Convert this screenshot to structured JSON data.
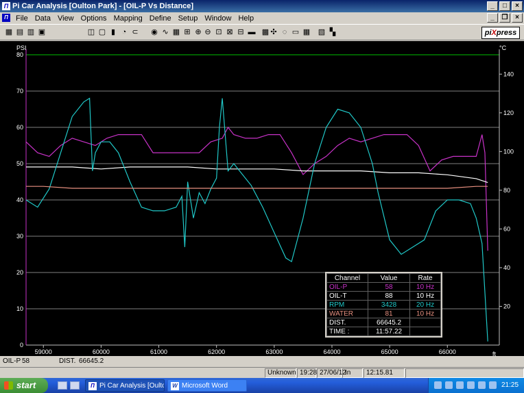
{
  "window": {
    "title": "Pi Car Analysis [Oulton Park] - [OIL-P Vs Distance]",
    "app_icon": "Π"
  },
  "menu": [
    "File",
    "Data",
    "View",
    "Options",
    "Mapping",
    "Define",
    "Setup",
    "Window",
    "Help"
  ],
  "logo": {
    "pre": "pi",
    "mid": "X",
    "post": "press"
  },
  "toolbar_icons": [
    "chart-icon",
    "open-icon",
    "save-icon",
    "print-icon",
    "new-window-icon",
    "folder-icon",
    "bar-icon",
    "gauge-icon",
    "link-icon",
    "eye-icon",
    "waveform-icon",
    "grid-split-icon",
    "cursor-icon",
    "zoom-in-icon",
    "zoom-out-icon",
    "zoom-box-icon",
    "zoom-fit-icon",
    "zoom-all-icon",
    "car-icon",
    "map-icon",
    "telemetry-icon",
    "track-icon",
    "race-car-icon",
    "table-icon",
    "compare-icon",
    "checker-icon"
  ],
  "chart_data": {
    "type": "line",
    "xlabel": "ft",
    "x_ticks": [
      59000,
      60000,
      61000,
      62000,
      63000,
      64000,
      65000,
      66000
    ],
    "xlim": [
      58700,
      66900
    ],
    "y_left": {
      "label": "PSI",
      "ticks": [
        0,
        10,
        20,
        30,
        40,
        50,
        60,
        70,
        80
      ],
      "lim": [
        0,
        80
      ]
    },
    "y_right": {
      "label": "°C",
      "ticks": [
        20,
        40,
        60,
        80,
        100,
        120,
        140
      ],
      "lim": [
        0,
        150
      ]
    },
    "series": [
      {
        "name": "OIL-P",
        "axis": "left",
        "color": "#c832c8",
        "x": [
          58700,
          58900,
          59100,
          59300,
          59500,
          59700,
          59900,
          60100,
          60300,
          60500,
          60700,
          60900,
          61100,
          61300,
          61500,
          61700,
          61900,
          62100,
          62200,
          62300,
          62500,
          62700,
          62900,
          63100,
          63300,
          63500,
          63700,
          63900,
          64100,
          64300,
          64500,
          64700,
          64900,
          65100,
          65300,
          65500,
          65700,
          65900,
          66100,
          66300,
          66500,
          66600,
          66650,
          66700
        ],
        "y": [
          56,
          53,
          52,
          55,
          57,
          56,
          55,
          57,
          58,
          58,
          58,
          53,
          53,
          53,
          53,
          53,
          56,
          57,
          60,
          58,
          57,
          57,
          58,
          58,
          53,
          47,
          50,
          52,
          55,
          57,
          56,
          57,
          58,
          58,
          58,
          55,
          48,
          51,
          52,
          52,
          52,
          58,
          53,
          26
        ]
      },
      {
        "name": "OIL-T",
        "axis": "right",
        "color": "#ffffff",
        "x": [
          58700,
          59000,
          59500,
          60000,
          60500,
          61000,
          61500,
          62000,
          62500,
          63000,
          63500,
          64000,
          64500,
          65000,
          65500,
          66000,
          66500,
          66700
        ],
        "y": [
          92,
          92,
          92,
          91,
          92,
          92,
          92,
          91,
          91,
          91,
          90,
          90,
          90,
          89,
          89,
          88,
          86,
          84
        ]
      },
      {
        "name": "RPM",
        "axis": "left",
        "color": "#20c8c8",
        "x": [
          58700,
          58900,
          59100,
          59300,
          59500,
          59700,
          59800,
          59850,
          59900,
          60000,
          60150,
          60300,
          60500,
          60700,
          60900,
          61100,
          61300,
          61400,
          61450,
          61500,
          61600,
          61700,
          61800,
          61900,
          62000,
          62050,
          62100,
          62200,
          62300,
          62400,
          62600,
          62800,
          63000,
          63200,
          63300,
          63500,
          63700,
          63900,
          64100,
          64300,
          64500,
          64700,
          64800,
          65000,
          65200,
          65400,
          65600,
          65800,
          66000,
          66200,
          66400,
          66500,
          66600,
          66700
        ],
        "y": [
          40,
          38,
          43,
          53,
          63,
          67,
          68,
          48,
          53,
          56,
          56,
          53,
          45,
          38,
          37,
          37,
          38,
          41,
          27,
          45,
          35,
          42,
          39,
          43,
          46,
          60,
          68,
          48,
          50,
          48,
          44,
          38,
          31,
          24,
          23,
          35,
          50,
          60,
          65,
          64,
          60,
          50,
          42,
          29,
          25,
          27,
          29,
          37,
          40,
          40,
          39,
          35,
          28,
          1
        ]
      },
      {
        "name": "WATER",
        "axis": "right",
        "color": "#e89080",
        "x": [
          58700,
          59000,
          59500,
          60000,
          60500,
          61000,
          61500,
          62000,
          62500,
          63000,
          63500,
          64000,
          64500,
          65000,
          65500,
          66000,
          66500,
          66700
        ],
        "y": [
          82,
          82,
          81,
          81,
          81,
          81,
          81,
          81,
          81,
          81,
          81,
          81,
          81,
          81,
          81,
          81,
          82,
          82
        ]
      }
    ]
  },
  "readout_table": {
    "headers": [
      "Channel",
      "Value",
      "Rate"
    ],
    "rows": [
      {
        "channel": "OIL-P",
        "value": "58",
        "rate": "10 Hz",
        "color": "#c832c8"
      },
      {
        "channel": "OIL-T",
        "value": "88",
        "rate": "10 Hz",
        "color": "#ffffff"
      },
      {
        "channel": "RPM",
        "value": "3428",
        "rate": "20 Hz",
        "color": "#20c8c8"
      },
      {
        "channel": "WATER",
        "value": "81",
        "rate": "10 Hz",
        "color": "#e89080"
      },
      {
        "channel": "DIST.",
        "value": "66645.2",
        "rate": "",
        "color": "#ffffff"
      },
      {
        "channel": "TIME :",
        "value": "11:57.22",
        "rate": "",
        "color": "#ffffff"
      }
    ]
  },
  "footer": {
    "oilp_label": "OIL-P",
    "oilp_value": "58",
    "dist_label": "DIST.",
    "dist_value": "66645.2"
  },
  "status": {
    "track": "Unknown",
    "time": "19:28",
    "date": "27/06/12",
    "mode": "In",
    "laptime": "12:15.81"
  },
  "taskbar": {
    "start": "start",
    "tasks": [
      {
        "label": "Pi Car Analysis [Oulto...",
        "icon": "Π",
        "active": true
      },
      {
        "label": "Microsoft Word",
        "icon": "W",
        "active": false
      }
    ],
    "clock": "21:25"
  }
}
